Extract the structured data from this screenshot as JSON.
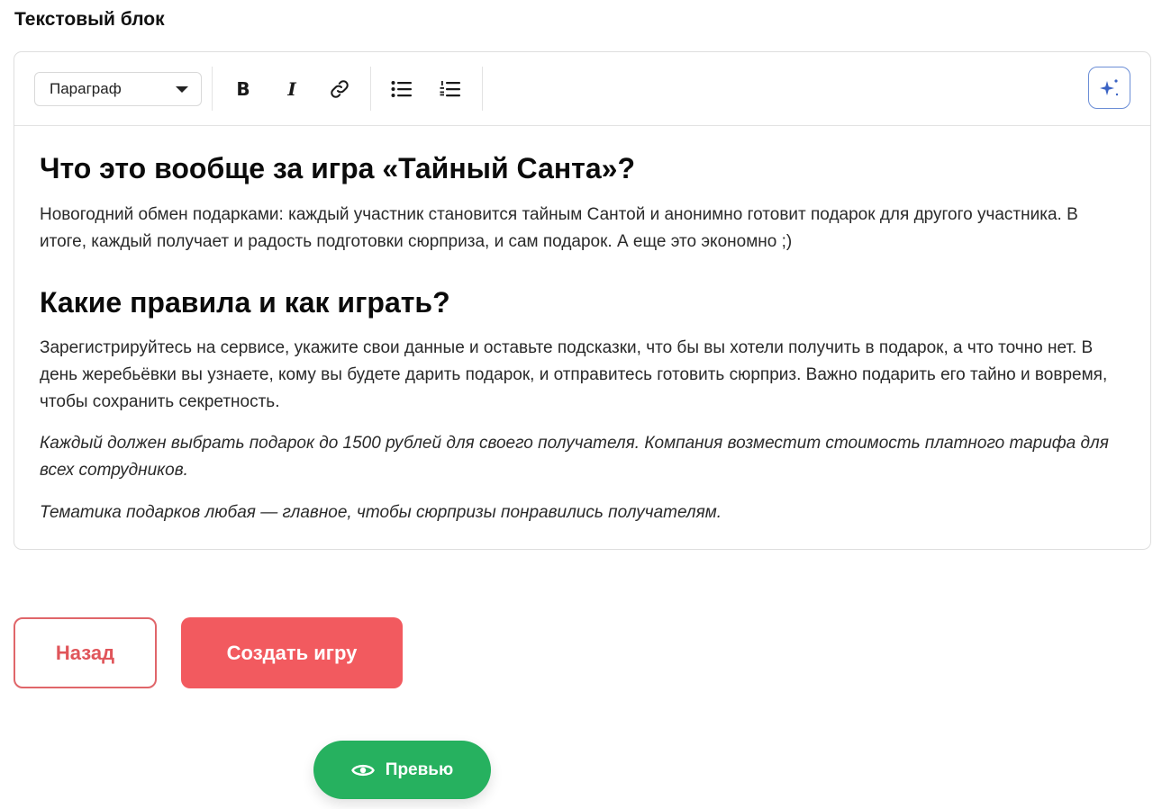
{
  "section_title": "Текстовый блок",
  "toolbar": {
    "block_type": "Параграф",
    "bold_label": "B",
    "italic_label": "I"
  },
  "content": {
    "heading1": "Что это вообще за игра «Тайный Санта»?",
    "paragraph1": "Новогодний обмен подарками: каждый участник становится тайным Сантой и анонимно готовит подарок для другого участника. В итоге, каждый получает и радость подготовки сюрприза, и сам подарок. А еще это экономно ;)",
    "heading2": "Какие правила и как играть?",
    "paragraph2": "Зарегистрируйтесь на сервисе, укажите свои данные и оставьте подсказки, что бы вы хотели получить в подарок, а что точно нет. В день жеребьёвки вы узнаете, кому вы будете дарить подарок, и отправитесь готовить сюрприз. Важно подарить его тайно и вовремя, чтобы сохранить секретность.",
    "paragraph3": "Каждый должен выбрать подарок до 1500 рублей для своего получателя. Компания возместит стоимость платного тарифа для всех сотрудников.",
    "paragraph4": "Тематика подарков любая — главное, чтобы сюрпризы понравились получателям."
  },
  "actions": {
    "back_label": "Назад",
    "create_label": "Создать игру",
    "preview_label": "Превью"
  },
  "colors": {
    "accent_red": "#f25a5f",
    "accent_green": "#26b15f",
    "ai_border": "#6b8ed6"
  }
}
